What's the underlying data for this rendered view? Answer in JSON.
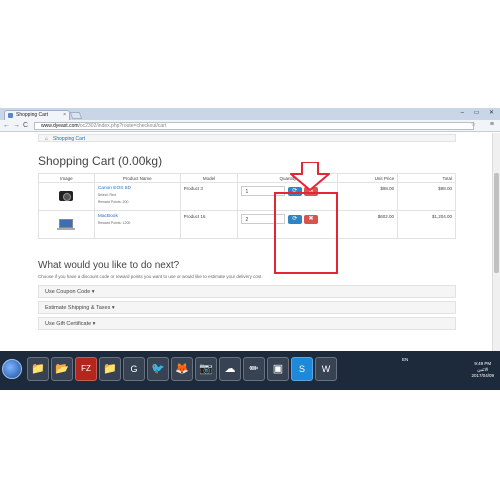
{
  "browser": {
    "tab_title": "Shopping Cart",
    "tab_close": "×",
    "url_host": "www.dyeast.com",
    "url_path": "/oc2302/index.php?route=checkout/cart",
    "window_controls": "– ▭ ✕",
    "back": "←",
    "forward": "→",
    "reload": "C",
    "star": "☆",
    "menu": "≡"
  },
  "page": {
    "breadcrumb_home": "⌂",
    "breadcrumb": "Shopping Cart",
    "title": "Shopping Cart  (0.00kg)",
    "headers": {
      "image": "Image",
      "product": "Product Name",
      "model": "Model",
      "quantity": "Quantity",
      "unit": "Unit Price",
      "total": "Total"
    },
    "items": [
      {
        "image_icon": "camera-icon",
        "name": "Canon EOS 5D",
        "option1": "Select: Red",
        "option2": "Reward Points: 200",
        "model": "Product 3",
        "qty": "1",
        "unit": "$98.00",
        "total": "$98.00"
      },
      {
        "image_icon": "laptop-icon",
        "name": "MacBook",
        "option1": "Reward Points: 1200",
        "model": "Product 16",
        "qty": "2",
        "unit": "$602.00",
        "total": "$1,204.00"
      }
    ],
    "update_icon": "⟳",
    "remove_icon": "✖",
    "next_heading": "What would you like to do next?",
    "next_sub": "Choose if you have a discount code or reward points you want to use or would like to estimate your delivery cost.",
    "accordions": [
      "Use Coupon Code ▾",
      "Estimate Shipping & Taxes ▾",
      "Use Gift Certificate ▾"
    ]
  },
  "taskbar": {
    "apps": [
      "📁",
      "📂",
      "FZ",
      "📁",
      "G",
      "🐦",
      "🦊",
      "📷",
      "☁",
      "✏",
      "▣",
      "S",
      "W"
    ],
    "lang": "EN",
    "time": "9:49 PM",
    "day": "الاثنين",
    "date": "2017/04/09"
  },
  "colors": {
    "annotation": "#e32636",
    "update_button": "#2f84c4",
    "remove_button": "#d9534f",
    "link": "#2a6ebd"
  }
}
